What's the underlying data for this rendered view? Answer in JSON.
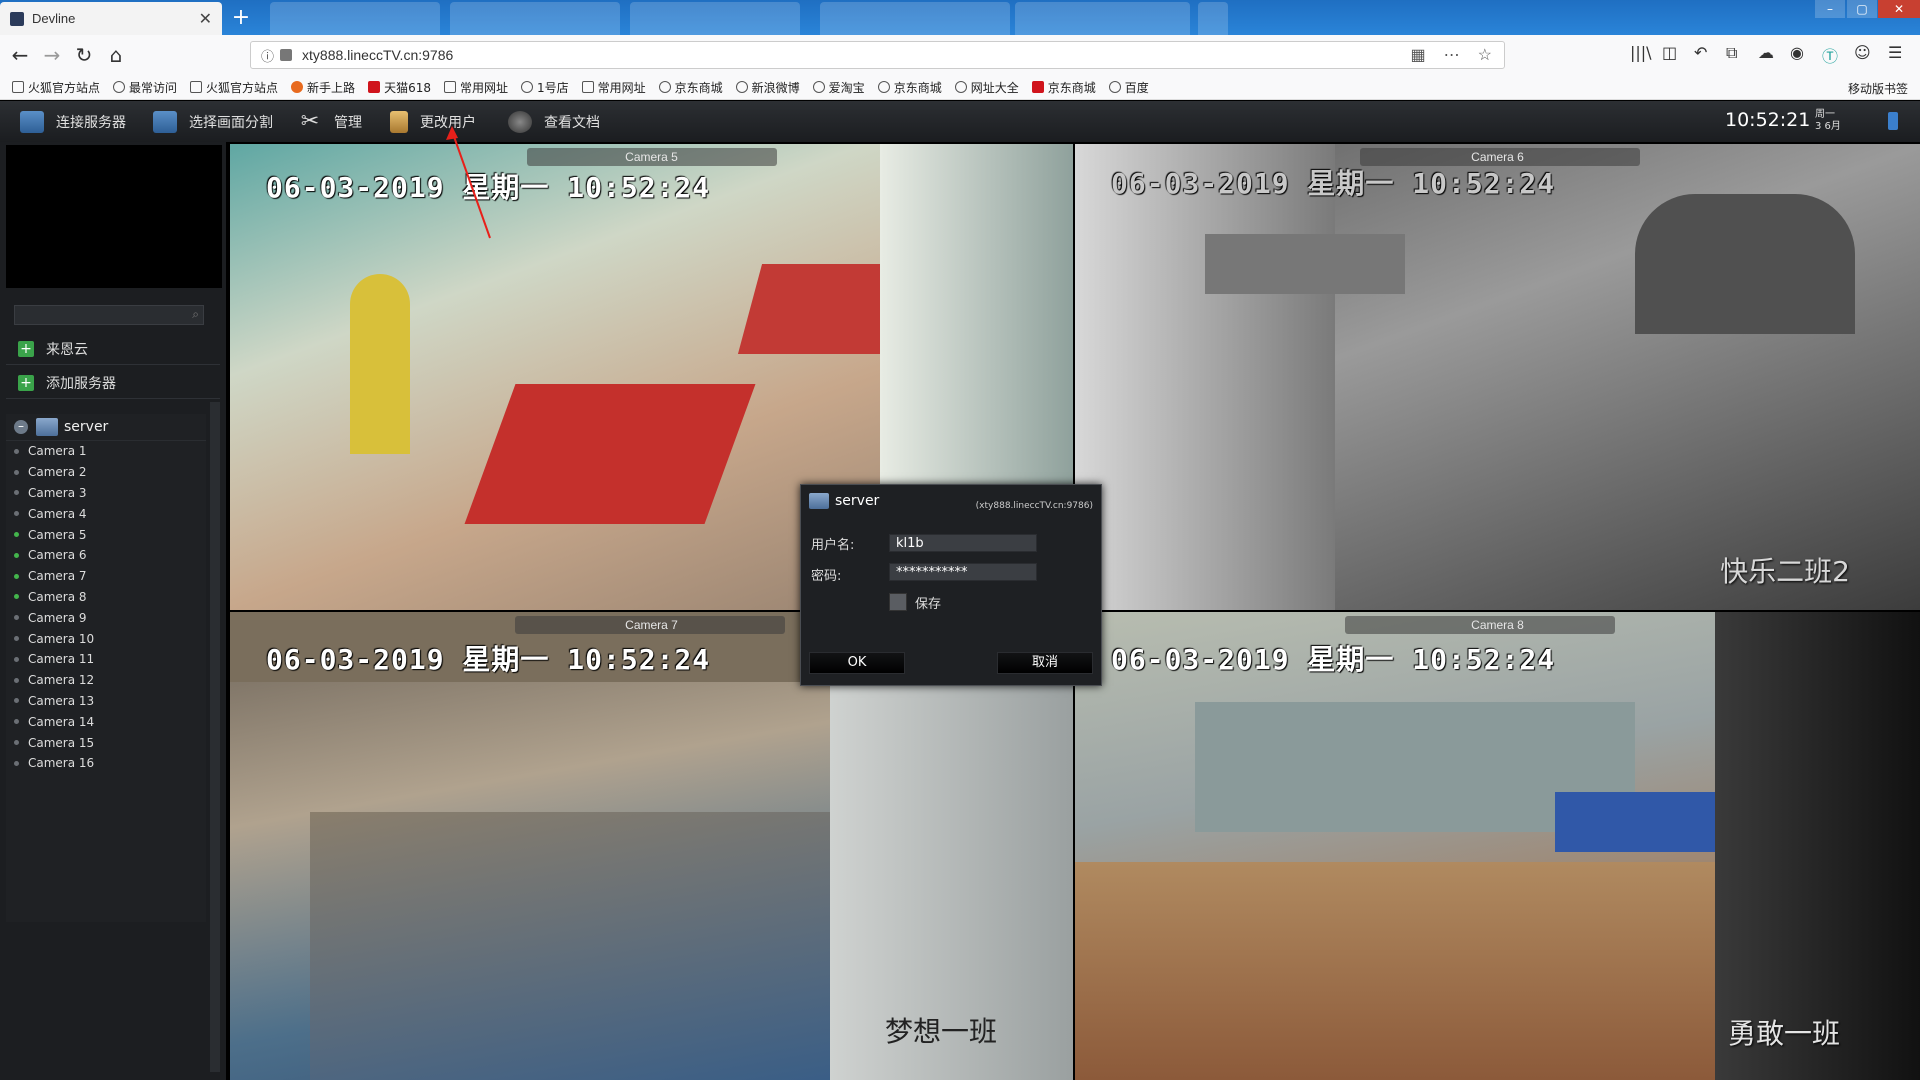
{
  "browser": {
    "active_tab": "Devline",
    "background_tabs": [
      "",
      "",
      "",
      "",
      "",
      ""
    ],
    "url": "xty888.lineccTV.cn:9786",
    "bookmarks": [
      "火狐官方站点",
      "最常访问",
      "火狐官方站点",
      "新手上路",
      "天猫618",
      "常用网址",
      "1号店",
      "常用网址",
      "京东商城",
      "新浪微博",
      "爱淘宝",
      "京东商城",
      "网址大全",
      "京东商城",
      "百度"
    ],
    "mobile_bookmarks": "移动版书签"
  },
  "toolbar": {
    "connect": "连接服务器",
    "layout": "选择画面分割",
    "manage": "管理",
    "change_user": "更改用户",
    "docs": "查看文档",
    "time": "10:52:21",
    "date_line1": "周一",
    "date_line2": "3 6月"
  },
  "sidebar": {
    "cloud": "来恩云",
    "add_server": "添加服务器",
    "server": "server",
    "cameras": [
      "Camera 1",
      "Camera 2",
      "Camera 3",
      "Camera 4",
      "Camera 5",
      "Camera 6",
      "Camera 7",
      "Camera 8",
      "Camera 9",
      "Camera 10",
      "Camera 11",
      "Camera 12",
      "Camera 13",
      "Camera 14",
      "Camera 15",
      "Camera 16"
    ],
    "camera_online": [
      false,
      false,
      false,
      false,
      true,
      true,
      true,
      true,
      false,
      false,
      false,
      false,
      false,
      false,
      false,
      false
    ]
  },
  "views": {
    "cam5": {
      "label": "Camera 5",
      "timestamp": "06-03-2019 星期一 10:52:24",
      "overlay": ""
    },
    "cam6": {
      "label": "Camera 6",
      "timestamp": "06-03-2019 星期一 10:52:24",
      "overlay": "快乐二班2"
    },
    "cam7": {
      "label": "Camera 7",
      "timestamp": "06-03-2019 星期一 10:52:24",
      "overlay": "梦想一班"
    },
    "cam8": {
      "label": "Camera 8",
      "timestamp": "06-03-2019 星期一 10:52:24",
      "overlay": "勇敢一班"
    }
  },
  "dialog": {
    "title": "server",
    "host": "(xty888.lineccTV.cn:9786)",
    "username_label": "用户名:",
    "username": "kl1b",
    "password_label": "密码:",
    "password": "***********",
    "save_label": "保存",
    "ok": "OK",
    "cancel": "取消"
  },
  "colors": {
    "accent_blue": "#2a84d8",
    "online_green": "#43b54c",
    "annotation_red": "#e8201a"
  }
}
